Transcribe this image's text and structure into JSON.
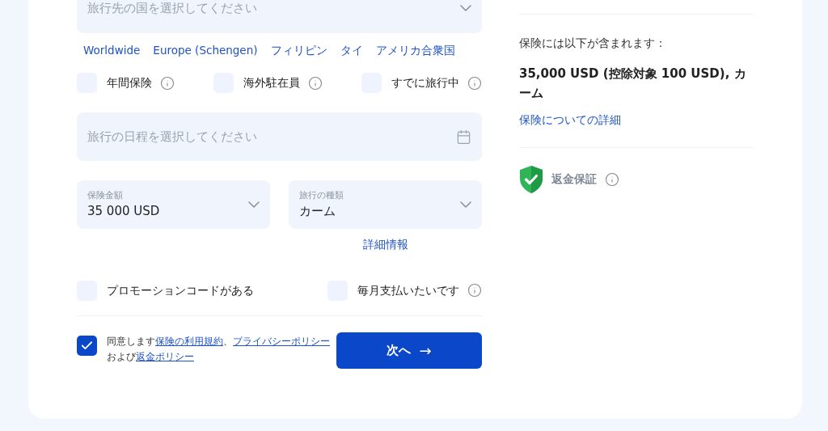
{
  "destination": {
    "placeholder": "旅行先の国を選択してください"
  },
  "quick_countries": [
    "Worldwide",
    "Europe (Schengen)",
    "フィリピン",
    "タイ",
    "アメリカ合衆国"
  ],
  "options": [
    {
      "label": "年間保険",
      "checked": false,
      "info": true
    },
    {
      "label": "海外駐在員",
      "checked": false,
      "info": true
    },
    {
      "label": "すでに旅行中",
      "checked": false,
      "info": true
    }
  ],
  "dates": {
    "placeholder": "旅行の日程を選択してください"
  },
  "coverage": {
    "label": "保険金額",
    "value": "35 000 USD"
  },
  "trip_type": {
    "label": "旅行の種類",
    "value": "カーム"
  },
  "details_link": "詳細情報",
  "extras": [
    {
      "label": "プロモーションコードがある",
      "checked": false,
      "info": false
    },
    {
      "label": "毎月支払いたいです",
      "checked": false,
      "info": true
    }
  ],
  "consent": {
    "checked": true,
    "segments": [
      {
        "kind": "text",
        "text": "同意します"
      },
      {
        "kind": "link",
        "text": "保険の利用規約"
      },
      {
        "kind": "text",
        "text": "、"
      },
      {
        "kind": "link",
        "text": "プライバシーポリシー"
      },
      {
        "kind": "break"
      },
      {
        "kind": "text",
        "text": "および"
      },
      {
        "kind": "link",
        "text": "返金ポリシー"
      }
    ]
  },
  "next_button": {
    "label": "次へ",
    "arrow": "→"
  },
  "summary": {
    "heading": "保険には以下が含まれます：",
    "value": "35,000 USD (控除対象 100 USD), カーム",
    "link": "保険についての詳細",
    "guarantee": "返金保証"
  }
}
